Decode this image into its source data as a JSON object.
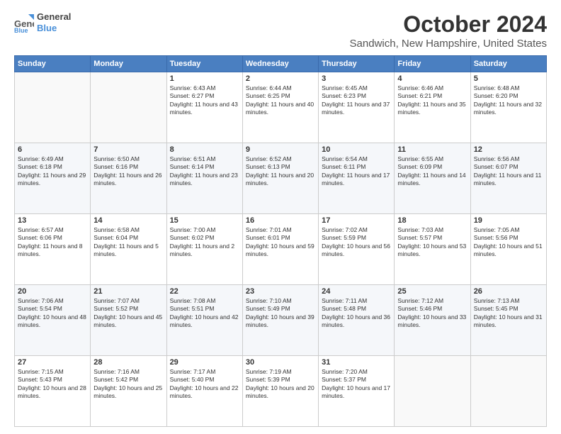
{
  "header": {
    "logo_line1": "General",
    "logo_line2": "Blue",
    "month": "October 2024",
    "location": "Sandwich, New Hampshire, United States"
  },
  "weekdays": [
    "Sunday",
    "Monday",
    "Tuesday",
    "Wednesday",
    "Thursday",
    "Friday",
    "Saturday"
  ],
  "weeks": [
    [
      {
        "day": "",
        "info": ""
      },
      {
        "day": "",
        "info": ""
      },
      {
        "day": "1",
        "info": "Sunrise: 6:43 AM\nSunset: 6:27 PM\nDaylight: 11 hours and 43 minutes."
      },
      {
        "day": "2",
        "info": "Sunrise: 6:44 AM\nSunset: 6:25 PM\nDaylight: 11 hours and 40 minutes."
      },
      {
        "day": "3",
        "info": "Sunrise: 6:45 AM\nSunset: 6:23 PM\nDaylight: 11 hours and 37 minutes."
      },
      {
        "day": "4",
        "info": "Sunrise: 6:46 AM\nSunset: 6:21 PM\nDaylight: 11 hours and 35 minutes."
      },
      {
        "day": "5",
        "info": "Sunrise: 6:48 AM\nSunset: 6:20 PM\nDaylight: 11 hours and 32 minutes."
      }
    ],
    [
      {
        "day": "6",
        "info": "Sunrise: 6:49 AM\nSunset: 6:18 PM\nDaylight: 11 hours and 29 minutes."
      },
      {
        "day": "7",
        "info": "Sunrise: 6:50 AM\nSunset: 6:16 PM\nDaylight: 11 hours and 26 minutes."
      },
      {
        "day": "8",
        "info": "Sunrise: 6:51 AM\nSunset: 6:14 PM\nDaylight: 11 hours and 23 minutes."
      },
      {
        "day": "9",
        "info": "Sunrise: 6:52 AM\nSunset: 6:13 PM\nDaylight: 11 hours and 20 minutes."
      },
      {
        "day": "10",
        "info": "Sunrise: 6:54 AM\nSunset: 6:11 PM\nDaylight: 11 hours and 17 minutes."
      },
      {
        "day": "11",
        "info": "Sunrise: 6:55 AM\nSunset: 6:09 PM\nDaylight: 11 hours and 14 minutes."
      },
      {
        "day": "12",
        "info": "Sunrise: 6:56 AM\nSunset: 6:07 PM\nDaylight: 11 hours and 11 minutes."
      }
    ],
    [
      {
        "day": "13",
        "info": "Sunrise: 6:57 AM\nSunset: 6:06 PM\nDaylight: 11 hours and 8 minutes."
      },
      {
        "day": "14",
        "info": "Sunrise: 6:58 AM\nSunset: 6:04 PM\nDaylight: 11 hours and 5 minutes."
      },
      {
        "day": "15",
        "info": "Sunrise: 7:00 AM\nSunset: 6:02 PM\nDaylight: 11 hours and 2 minutes."
      },
      {
        "day": "16",
        "info": "Sunrise: 7:01 AM\nSunset: 6:01 PM\nDaylight: 10 hours and 59 minutes."
      },
      {
        "day": "17",
        "info": "Sunrise: 7:02 AM\nSunset: 5:59 PM\nDaylight: 10 hours and 56 minutes."
      },
      {
        "day": "18",
        "info": "Sunrise: 7:03 AM\nSunset: 5:57 PM\nDaylight: 10 hours and 53 minutes."
      },
      {
        "day": "19",
        "info": "Sunrise: 7:05 AM\nSunset: 5:56 PM\nDaylight: 10 hours and 51 minutes."
      }
    ],
    [
      {
        "day": "20",
        "info": "Sunrise: 7:06 AM\nSunset: 5:54 PM\nDaylight: 10 hours and 48 minutes."
      },
      {
        "day": "21",
        "info": "Sunrise: 7:07 AM\nSunset: 5:52 PM\nDaylight: 10 hours and 45 minutes."
      },
      {
        "day": "22",
        "info": "Sunrise: 7:08 AM\nSunset: 5:51 PM\nDaylight: 10 hours and 42 minutes."
      },
      {
        "day": "23",
        "info": "Sunrise: 7:10 AM\nSunset: 5:49 PM\nDaylight: 10 hours and 39 minutes."
      },
      {
        "day": "24",
        "info": "Sunrise: 7:11 AM\nSunset: 5:48 PM\nDaylight: 10 hours and 36 minutes."
      },
      {
        "day": "25",
        "info": "Sunrise: 7:12 AM\nSunset: 5:46 PM\nDaylight: 10 hours and 33 minutes."
      },
      {
        "day": "26",
        "info": "Sunrise: 7:13 AM\nSunset: 5:45 PM\nDaylight: 10 hours and 31 minutes."
      }
    ],
    [
      {
        "day": "27",
        "info": "Sunrise: 7:15 AM\nSunset: 5:43 PM\nDaylight: 10 hours and 28 minutes."
      },
      {
        "day": "28",
        "info": "Sunrise: 7:16 AM\nSunset: 5:42 PM\nDaylight: 10 hours and 25 minutes."
      },
      {
        "day": "29",
        "info": "Sunrise: 7:17 AM\nSunset: 5:40 PM\nDaylight: 10 hours and 22 minutes."
      },
      {
        "day": "30",
        "info": "Sunrise: 7:19 AM\nSunset: 5:39 PM\nDaylight: 10 hours and 20 minutes."
      },
      {
        "day": "31",
        "info": "Sunrise: 7:20 AM\nSunset: 5:37 PM\nDaylight: 10 hours and 17 minutes."
      },
      {
        "day": "",
        "info": ""
      },
      {
        "day": "",
        "info": ""
      }
    ]
  ]
}
